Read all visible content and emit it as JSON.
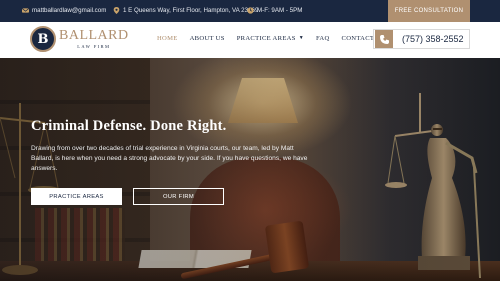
{
  "topbar": {
    "email": "mattballardlaw@gmail.com",
    "address": "1 E Queens Way, First Floor, Hampton, VA 23669",
    "hours": "M-F: 9AM - 5PM",
    "cta_label": "FREE CONSULTATION"
  },
  "header": {
    "logo_letter": "B",
    "logo_name": "BALLARD",
    "logo_sub": "LAW FIRM",
    "nav": [
      {
        "label": "HOME",
        "active": true
      },
      {
        "label": "ABOUT US",
        "active": false
      },
      {
        "label": "PRACTICE AREAS",
        "active": false,
        "dropdown": true
      },
      {
        "label": "FAQ",
        "active": false
      },
      {
        "label": "CONTACT",
        "active": false
      }
    ],
    "phone": "(757) 358-2552"
  },
  "hero": {
    "title": "Criminal Defense. Done Right.",
    "text": "Drawing from over two decades of trial experience in Virginia courts, our team, led by Matt Ballard, is here when you need a strong advocate by your side. If you have questions, we have answers.",
    "primary_button": "PRACTICE AREAS",
    "secondary_button": "OUR FIRM"
  },
  "colors": {
    "navy": "#1a2740",
    "gold": "#b09070"
  },
  "icons": [
    "email-icon",
    "location-icon",
    "clock-icon",
    "phone-icon",
    "chevron-down-icon"
  ]
}
